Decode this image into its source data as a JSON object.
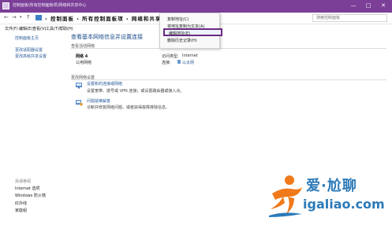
{
  "window": {
    "title": "控制面板\\所有控制面板项\\网络和共享中心",
    "minimize": "—",
    "maximize": "□",
    "close": "✕",
    "accent": "#7b3f98"
  },
  "address": {
    "back": "←",
    "forward": "→",
    "recent": "▾",
    "up": "↑",
    "breadcrumb": "› 控制面板 › 所有控制面板项 › 网络和共享中",
    "search_placeholder": "搜索控制面板"
  },
  "menu": {
    "file": "文件(F)",
    "edit": "编辑(E)",
    "view": "查看(V)",
    "tools": "工具(T)",
    "help": "帮助(H)"
  },
  "sidebar": {
    "home": "控制面板主页",
    "adapter": "更改适配器设置",
    "sharing": "更改高级共享设置",
    "see_also": "另请参阅",
    "bottom": [
      "Internet 选项",
      "Windows 防火墙",
      "红外线",
      "家庭组"
    ]
  },
  "main": {
    "title": "查看基本网络信息并设置连接",
    "active_networks": "查看活动网络",
    "network_name": "网络 4",
    "network_type": "公用网络",
    "access_label": "访问类型:",
    "access_value": "Internet",
    "connection_label": "连接:",
    "connection_value": "以太网",
    "change_settings": "更改网络设置",
    "tasks": [
      {
        "link": "设置新的连接或网络",
        "desc": "设置宽带、拨号或 VPN 连接；或设置路由器或接入点。"
      },
      {
        "link": "问题疑难解答",
        "desc": "诊断并修复网络问题，或者获得故障排除信息。"
      }
    ]
  },
  "context_menu": {
    "items": [
      "复制地址(C)",
      "将地址复制为文本(A)",
      "编辑地址(E)",
      "删除历史记录(H)"
    ],
    "highlight_color": "#6b2a83"
  },
  "watermark": {
    "cn": "爱·尬聊",
    "en": "igaliao.com"
  }
}
